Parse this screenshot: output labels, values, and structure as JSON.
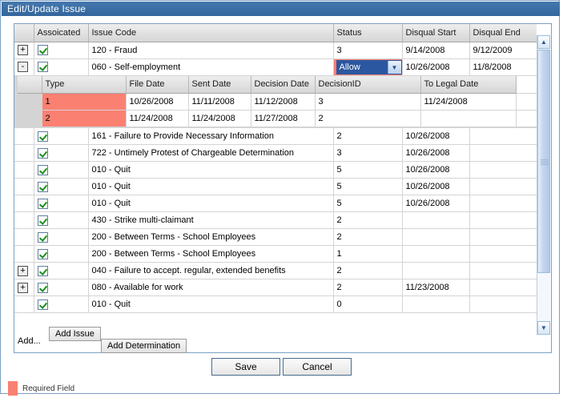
{
  "window": {
    "title": "Edit/Update Issue"
  },
  "grid": {
    "headers": {
      "expand": "",
      "associated": "Assoicated",
      "issue_code": "Issue Code",
      "status": "Status",
      "disqual_start": "Disqual Start",
      "disqual_end": "Disqual End"
    },
    "rows": [
      {
        "expander": "+",
        "checked": true,
        "issue_code": "120 - Fraud",
        "status": "3",
        "disqual_start": "9/14/2008",
        "disqual_end": "9/12/2009",
        "status_is_combo": false
      },
      {
        "expander": "-",
        "checked": true,
        "issue_code": "060 - Self-employment",
        "status": "Allow",
        "disqual_start": "10/26/2008",
        "disqual_end": "11/8/2008",
        "status_is_combo": true
      },
      {
        "expander": "",
        "checked": true,
        "issue_code": "161 - Failure to Provide Necessary Information",
        "status": "2",
        "disqual_start": "10/26/2008",
        "disqual_end": ""
      },
      {
        "expander": "",
        "checked": true,
        "issue_code": "722 - Untimely Protest of Chargeable Determination",
        "status": "3",
        "disqual_start": "10/26/2008",
        "disqual_end": ""
      },
      {
        "expander": "",
        "checked": true,
        "issue_code": "010 - Quit",
        "status": "5",
        "disqual_start": "10/26/2008",
        "disqual_end": ""
      },
      {
        "expander": "",
        "checked": true,
        "issue_code": "010 - Quit",
        "status": "5",
        "disqual_start": "10/26/2008",
        "disqual_end": ""
      },
      {
        "expander": "",
        "checked": true,
        "issue_code": "010 - Quit",
        "status": "5",
        "disqual_start": "10/26/2008",
        "disqual_end": ""
      },
      {
        "expander": "",
        "checked": true,
        "issue_code": "430 - Strike multi-claimant",
        "status": "2",
        "disqual_start": "",
        "disqual_end": ""
      },
      {
        "expander": "",
        "checked": true,
        "issue_code": "200 - Between Terms - School Employees",
        "status": "2",
        "disqual_start": "",
        "disqual_end": ""
      },
      {
        "expander": "",
        "checked": true,
        "issue_code": "200 - Between Terms - School Employees",
        "status": "1",
        "disqual_start": "",
        "disqual_end": ""
      },
      {
        "expander": "+",
        "checked": true,
        "issue_code": "040 - Failure to accept. regular, extended benefits",
        "status": "2",
        "disqual_start": "",
        "disqual_end": ""
      },
      {
        "expander": "+",
        "checked": true,
        "issue_code": "080 - Available for work",
        "status": "2",
        "disqual_start": "11/23/2008",
        "disqual_end": ""
      },
      {
        "expander": "",
        "checked": true,
        "issue_code": "010 - Quit",
        "status": "0",
        "disqual_start": "",
        "disqual_end": ""
      }
    ]
  },
  "subgrid": {
    "headers": {
      "type": "Type",
      "file_date": "File Date",
      "sent_date": "Sent Date",
      "decision_date": "Decision Date",
      "decision_id": "DecisionID",
      "to_legal_date": "To Legal Date"
    },
    "rows": [
      {
        "type": "1",
        "file_date": "10/26/2008",
        "sent_date": "11/11/2008",
        "decision_date": "11/12/2008",
        "decision_id": "3",
        "to_legal_date": "11/24/2008"
      },
      {
        "type": "2",
        "file_date": "11/24/2008",
        "sent_date": "11/24/2008",
        "decision_date": "11/27/2008",
        "decision_id": "2",
        "to_legal_date": ""
      }
    ]
  },
  "add_bar": {
    "label": "Add...",
    "add_issue": "Add Issue",
    "add_determination": "Add Determination"
  },
  "footer": {
    "save": "Save",
    "cancel": "Cancel",
    "legend": "Required Field"
  },
  "scrollbar": {
    "up_arrow": "▲",
    "down_arrow": "▼"
  },
  "colors": {
    "required_field": "#fa8072",
    "title_bar": "#3a6ea5",
    "combo_highlight": "#2b57a0"
  }
}
